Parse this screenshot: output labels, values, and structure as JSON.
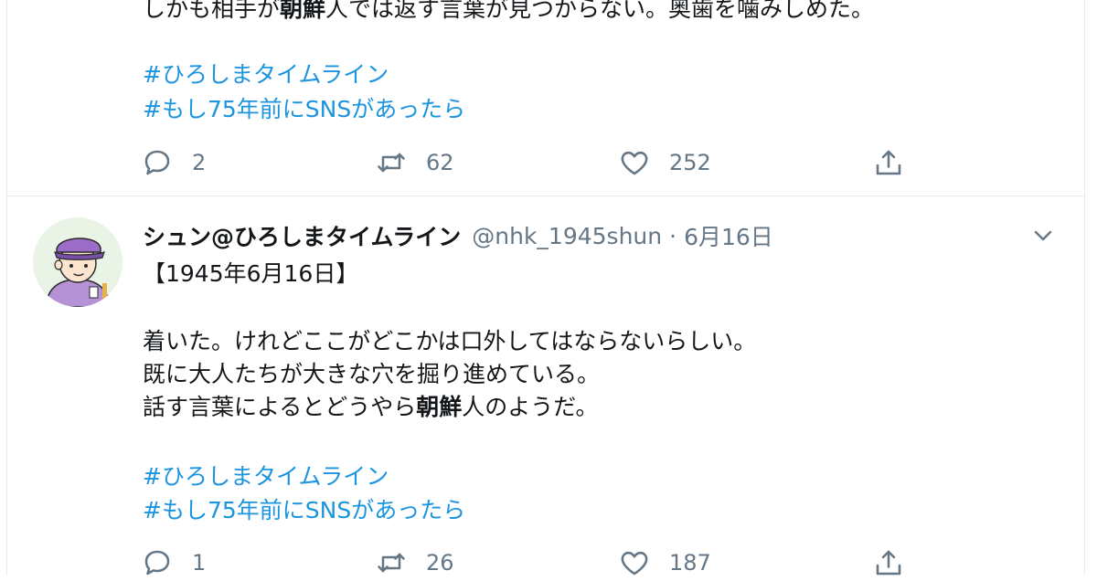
{
  "tweet_top": {
    "text_line": [
      "しかも相手が",
      "朝鮮",
      "人では返す言葉が見つからない。奥歯を噛みしめた。"
    ],
    "hashtags": [
      "#ひろしまタイムライン",
      "#もし75年前にSNSがあったら"
    ],
    "actions": {
      "reply_count": "2",
      "retweet_count": "62",
      "like_count": "252"
    }
  },
  "tweet_main": {
    "author_name": "シュン@ひろしまタイムライン",
    "handle": "@nhk_1945shun",
    "separator": "·",
    "date": "6月16日",
    "lines": [
      {
        "parts": [
          "【1945年6月16日】"
        ]
      },
      {
        "parts": [
          "着いた。けれどここがどこかは口外してはならないらしい。"
        ]
      },
      {
        "parts": [
          "既に大人たちが大きな穴を掘り進めている。"
        ]
      },
      {
        "parts": [
          "話す言葉によるとどうやら",
          "朝鮮",
          "人のようだ。"
        ]
      }
    ],
    "hashtags": [
      "#ひろしまタイムライン",
      "#もし75年前にSNSがあったら"
    ],
    "actions": {
      "reply_count": "1",
      "retweet_count": "26",
      "like_count": "187"
    }
  },
  "colors": {
    "text": "#14171a",
    "secondary": "#657786",
    "link": "#1b95e0",
    "divider": "#e6ecf0"
  },
  "icons": [
    "reply-icon",
    "retweet-icon",
    "like-icon",
    "share-icon",
    "chevron-down-icon"
  ]
}
